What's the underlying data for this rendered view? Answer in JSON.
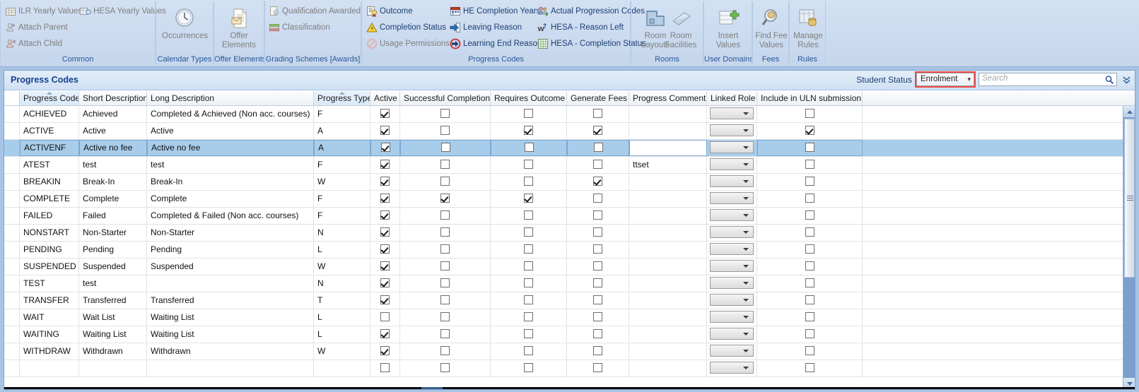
{
  "ribbon": {
    "groups": [
      {
        "name": "Common",
        "label": "Common",
        "items": [
          {
            "label": "ILR Yearly Values",
            "icon": "grid-table-icon",
            "enabled": false
          },
          {
            "label": "HESA Yearly Values",
            "icon": "hesa-grid-icon",
            "enabled": false
          },
          {
            "label": "Attach Parent",
            "icon": "attach-parent-icon",
            "enabled": false
          },
          {
            "label": "Attach Child",
            "icon": "attach-child-icon",
            "enabled": false
          }
        ]
      },
      {
        "name": "Calendar Types",
        "label": "Calendar Types",
        "items": [
          {
            "label": "Occurrences",
            "icon": "clock-icon",
            "enabled": false
          }
        ]
      },
      {
        "name": "Offer Elements",
        "label": "Offer Elements",
        "items": [
          {
            "label": "Offer Elements",
            "icon": "document-envelope-icon",
            "enabled": false
          }
        ]
      },
      {
        "name": "Grading Schemes [Awards]",
        "label": "Grading Schemes [Awards]",
        "items": [
          {
            "label": "Qualification Awarded",
            "icon": "certificate-icon",
            "enabled": false
          },
          {
            "label": "Classification",
            "icon": "classification-icon",
            "enabled": false
          }
        ]
      },
      {
        "name": "Progress Codes",
        "label": "Progress Codes",
        "items": [
          {
            "label": "Outcome",
            "icon": "outcome-ribbon-icon",
            "enabled": true
          },
          {
            "label": "Completion Status",
            "icon": "warning-triangle-icon",
            "enabled": true
          },
          {
            "label": "Usage Permissions",
            "icon": "no-entry-icon",
            "enabled": false
          },
          {
            "label": "HE Completion Years",
            "icon": "calendar-icon",
            "enabled": true
          },
          {
            "label": "Leaving Reason",
            "icon": "exit-arrow-icon",
            "enabled": true
          },
          {
            "label": "Learning End Reason",
            "icon": "red-circle-arrow-icon",
            "enabled": true
          },
          {
            "label": "Actual Progression Codes",
            "icon": "people-green-arrow-icon",
            "enabled": true
          },
          {
            "label": "HESA - Reason Left",
            "icon": "w-question-icon",
            "enabled": true
          },
          {
            "label": "HESA - Completion Status",
            "icon": "green-grid-icon",
            "enabled": true
          }
        ]
      },
      {
        "name": "Rooms",
        "label": "Rooms",
        "items": [
          {
            "label": "Room Layouts",
            "icon": "floorplan-icon",
            "enabled": false
          },
          {
            "label": "Room Facilities",
            "icon": "projector-icon",
            "enabled": false
          }
        ]
      },
      {
        "name": "User Domains",
        "label": "User Domains",
        "items": [
          {
            "label": "Insert Values",
            "icon": "insert-values-icon",
            "enabled": false
          }
        ]
      },
      {
        "name": "Fees",
        "label": "Fees",
        "items": [
          {
            "label": "Find Fee Values",
            "icon": "magnifier-coin-icon",
            "enabled": false
          }
        ]
      },
      {
        "name": "Rules",
        "label": "Rules",
        "items": [
          {
            "label": "Manage Rules",
            "icon": "manage-rules-icon",
            "enabled": false
          }
        ]
      }
    ]
  },
  "panel": {
    "title": "Progress Codes",
    "student_status_label": "Student Status",
    "student_status_value": "Enrolment",
    "search_placeholder": "Search",
    "highlight_color": "#f0483e",
    "selection_color": "#a8cdeb"
  },
  "grid": {
    "columns": [
      {
        "key": "progress_code",
        "label": "Progress Code",
        "sorted": true
      },
      {
        "key": "short_description",
        "label": "Short Description",
        "sorted": false
      },
      {
        "key": "long_description",
        "label": "Long Description",
        "sorted": false
      },
      {
        "key": "progress_type",
        "label": "Progress Type",
        "sorted": true
      },
      {
        "key": "active",
        "label": "Active",
        "sorted": false
      },
      {
        "key": "successful_completion",
        "label": "Successful Completion",
        "sorted": false
      },
      {
        "key": "requires_outcome",
        "label": "Requires Outcome",
        "sorted": false
      },
      {
        "key": "generate_fees",
        "label": "Generate Fees",
        "sorted": false
      },
      {
        "key": "progress_comment",
        "label": "Progress Comment",
        "sorted": false
      },
      {
        "key": "linked_role",
        "label": "Linked Role",
        "sorted": false
      },
      {
        "key": "include_in_uln",
        "label": "Include in ULN submission",
        "sorted": false
      },
      {
        "key": "filler",
        "label": "",
        "sorted": false
      }
    ],
    "rows": [
      {
        "progress_code": "ACHIEVED",
        "short_description": "Achieved",
        "long_description": "Completed & Achieved (Non acc. courses)",
        "progress_type": "F",
        "active": true,
        "successful_completion": false,
        "requires_outcome": false,
        "generate_fees": false,
        "progress_comment": "",
        "linked_role": "",
        "include_in_uln": false,
        "selected": false
      },
      {
        "progress_code": "ACTIVE",
        "short_description": "Active",
        "long_description": "Active",
        "progress_type": "A",
        "active": true,
        "successful_completion": false,
        "requires_outcome": true,
        "generate_fees": true,
        "progress_comment": "",
        "linked_role": "",
        "include_in_uln": true,
        "selected": false
      },
      {
        "progress_code": "ACTIVENF",
        "short_description": "Active no fee",
        "long_description": "Active no fee",
        "progress_type": "A",
        "active": true,
        "successful_completion": false,
        "requires_outcome": false,
        "generate_fees": false,
        "progress_comment": "",
        "linked_role": "",
        "include_in_uln": false,
        "selected": true
      },
      {
        "progress_code": "ATEST",
        "short_description": "test",
        "long_description": "test",
        "progress_type": "F",
        "active": true,
        "successful_completion": false,
        "requires_outcome": false,
        "generate_fees": false,
        "progress_comment": "ttset",
        "linked_role": "",
        "include_in_uln": false,
        "selected": false
      },
      {
        "progress_code": "BREAKIN",
        "short_description": "Break-In",
        "long_description": "Break-In",
        "progress_type": "W",
        "active": true,
        "successful_completion": false,
        "requires_outcome": false,
        "generate_fees": true,
        "progress_comment": "",
        "linked_role": "",
        "include_in_uln": false,
        "selected": false
      },
      {
        "progress_code": "COMPLETE",
        "short_description": "Complete",
        "long_description": "Complete",
        "progress_type": "F",
        "active": true,
        "successful_completion": true,
        "requires_outcome": true,
        "generate_fees": false,
        "progress_comment": "",
        "linked_role": "",
        "include_in_uln": false,
        "selected": false
      },
      {
        "progress_code": "FAILED",
        "short_description": "Failed",
        "long_description": "Completed & Failed (Non acc. courses)",
        "progress_type": "F",
        "active": true,
        "successful_completion": false,
        "requires_outcome": false,
        "generate_fees": false,
        "progress_comment": "",
        "linked_role": "",
        "include_in_uln": false,
        "selected": false
      },
      {
        "progress_code": "NONSTART",
        "short_description": "Non-Starter",
        "long_description": "Non-Starter",
        "progress_type": "N",
        "active": true,
        "successful_completion": false,
        "requires_outcome": false,
        "generate_fees": false,
        "progress_comment": "",
        "linked_role": "",
        "include_in_uln": false,
        "selected": false
      },
      {
        "progress_code": "PENDING",
        "short_description": "Pending",
        "long_description": "Pending",
        "progress_type": "L",
        "active": true,
        "successful_completion": false,
        "requires_outcome": false,
        "generate_fees": false,
        "progress_comment": "",
        "linked_role": "",
        "include_in_uln": false,
        "selected": false
      },
      {
        "progress_code": "SUSPENDED",
        "short_description": "Suspended",
        "long_description": "Suspended",
        "progress_type": "W",
        "active": true,
        "successful_completion": false,
        "requires_outcome": false,
        "generate_fees": false,
        "progress_comment": "",
        "linked_role": "",
        "include_in_uln": false,
        "selected": false
      },
      {
        "progress_code": "TEST",
        "short_description": "test",
        "long_description": "",
        "progress_type": "N",
        "active": true,
        "successful_completion": false,
        "requires_outcome": false,
        "generate_fees": false,
        "progress_comment": "",
        "linked_role": "",
        "include_in_uln": false,
        "selected": false
      },
      {
        "progress_code": "TRANSFER",
        "short_description": "Transferred",
        "long_description": "Transferred",
        "progress_type": "T",
        "active": true,
        "successful_completion": false,
        "requires_outcome": false,
        "generate_fees": false,
        "progress_comment": "",
        "linked_role": "",
        "include_in_uln": false,
        "selected": false
      },
      {
        "progress_code": "WAIT",
        "short_description": "Wait List",
        "long_description": "Waiting List",
        "progress_type": "L",
        "active": false,
        "successful_completion": false,
        "requires_outcome": false,
        "generate_fees": false,
        "progress_comment": "",
        "linked_role": "",
        "include_in_uln": false,
        "selected": false
      },
      {
        "progress_code": "WAITING",
        "short_description": "Waiting List",
        "long_description": "Waiting List",
        "progress_type": "L",
        "active": true,
        "successful_completion": false,
        "requires_outcome": false,
        "generate_fees": false,
        "progress_comment": "",
        "linked_role": "",
        "include_in_uln": false,
        "selected": false
      },
      {
        "progress_code": "WITHDRAW",
        "short_description": "Withdrawn",
        "long_description": "Withdrawn",
        "progress_type": "W",
        "active": true,
        "successful_completion": false,
        "requires_outcome": false,
        "generate_fees": false,
        "progress_comment": "",
        "linked_role": "",
        "include_in_uln": false,
        "selected": false
      },
      {
        "progress_code": "",
        "short_description": "",
        "long_description": "",
        "progress_type": "",
        "active": false,
        "successful_completion": false,
        "requires_outcome": false,
        "generate_fees": false,
        "progress_comment": "",
        "linked_role": "",
        "include_in_uln": false,
        "selected": false
      }
    ]
  }
}
